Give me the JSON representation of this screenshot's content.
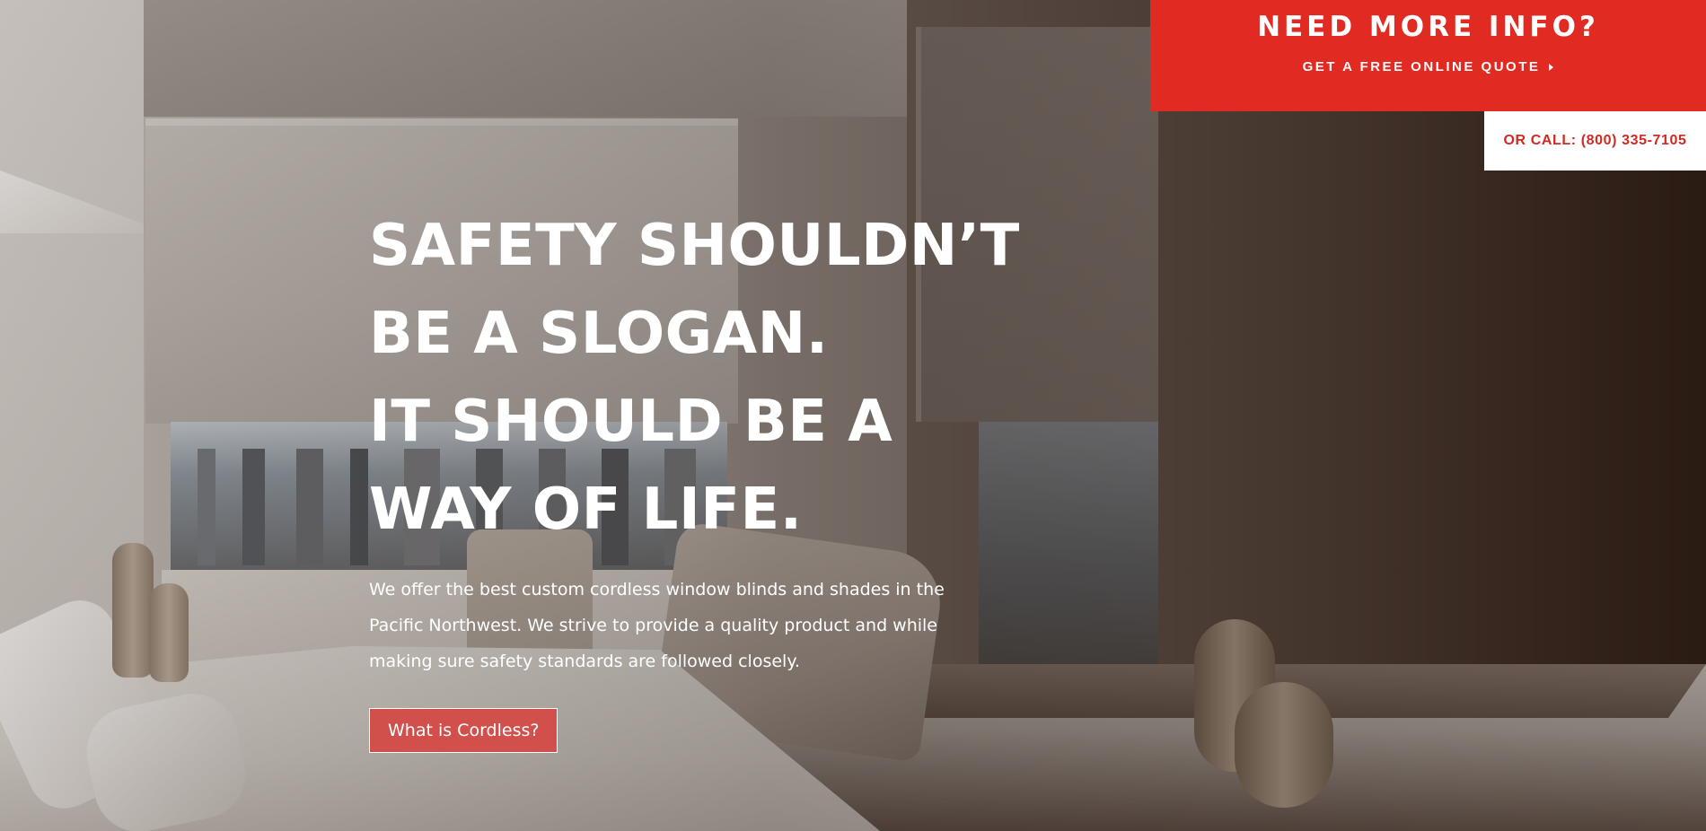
{
  "info_panel": {
    "title": "NEED MORE INFO?",
    "quote_link": "GET A FREE ONLINE QUOTE",
    "call": "OR CALL: (800) 335-7105",
    "accent_color": "#e12a21"
  },
  "hero": {
    "headline": [
      "SAFETY SHOULDN’T",
      "BE A SLOGAN.",
      "IT SHOULD BE A",
      "WAY OF LIFE."
    ],
    "description": "We offer the best custom cordless window blinds and shades in the Pacific Northwest. We strive to provide a quality product and while making sure safety standards are followed closely.",
    "cta_label": "What is Cordless?",
    "cta_color": "#d2504b"
  },
  "icons": {
    "quote_arrow": "caret-right-icon"
  }
}
